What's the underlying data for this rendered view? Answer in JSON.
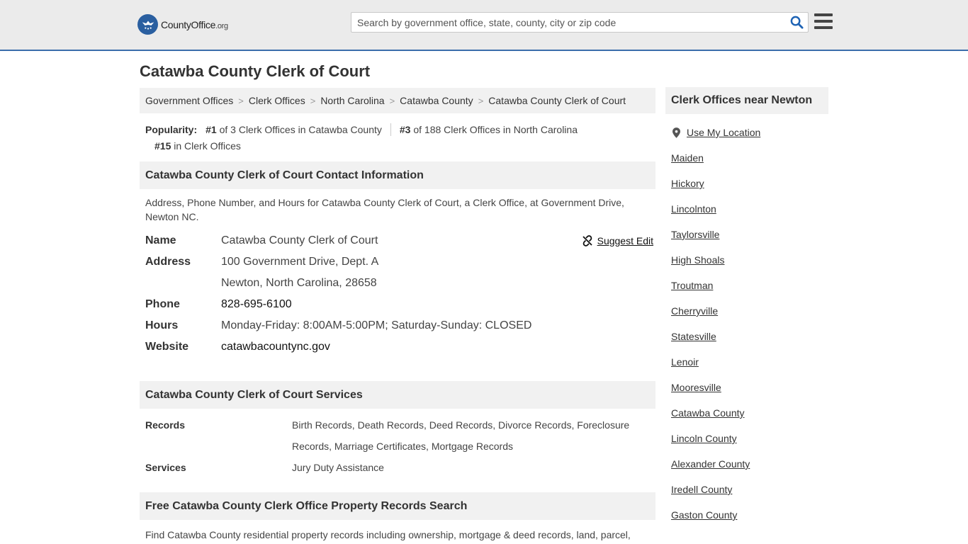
{
  "header": {
    "logo_text_main": "CountyOffice",
    "logo_text_tld": ".org",
    "search_placeholder": "Search by government office, state, county, city or zip code",
    "search_value": ""
  },
  "page": {
    "title": "Catawba County Clerk of Court"
  },
  "breadcrumb": [
    "Government Offices",
    "Clerk Offices",
    "North Carolina",
    "Catawba County",
    "Catawba County Clerk of Court"
  ],
  "popularity": {
    "label": "Popularity:",
    "rank1": "#1",
    "rank1_text": "of 3 Clerk Offices in Catawba County",
    "rank2": "#3",
    "rank2_text": "of 188 Clerk Offices in North Carolina",
    "rank3": "#15",
    "rank3_text": "in Clerk Offices"
  },
  "contact": {
    "header": "Catawba County Clerk of Court Contact Information",
    "description": "Address, Phone Number, and Hours for Catawba County Clerk of Court, a Clerk Office, at Government Drive, Newton NC.",
    "suggest_edit": "Suggest Edit",
    "name_label": "Name",
    "name": "Catawba County Clerk of Court",
    "address_label": "Address",
    "address_line1": "100 Government Drive, Dept. A",
    "address_line2": "Newton, North Carolina, 28658",
    "phone_label": "Phone",
    "phone": "828-695-6100",
    "hours_label": "Hours",
    "hours": "Monday-Friday: 8:00AM-5:00PM; Saturday-Sunday: CLOSED",
    "website_label": "Website",
    "website": "catawbacountync.gov"
  },
  "services": {
    "header": "Catawba County Clerk of Court Services",
    "records_label": "Records",
    "records": "Birth Records, Death Records, Deed Records, Divorce Records, Foreclosure Records, Marriage Certificates, Mortgage Records",
    "services_label": "Services",
    "services": "Jury Duty Assistance"
  },
  "property": {
    "header": "Free Catawba County Clerk Office Property Records Search",
    "description": "Find Catawba County residential property records including ownership, mortgage & deed records, land, parcel,"
  },
  "sidebar": {
    "header": "Clerk Offices near Newton",
    "use_location": "Use My Location",
    "items": [
      "Maiden",
      "Hickory",
      "Lincolnton",
      "Taylorsville",
      "High Shoals",
      "Troutman",
      "Cherryville",
      "Statesville",
      "Lenoir",
      "Mooresville",
      "Catawba County",
      "Lincoln County",
      "Alexander County",
      "Iredell County",
      "Gaston County"
    ]
  },
  "colors": {
    "brand_blue": "#2a5fa0",
    "header_bg": "#ebebeb",
    "section_bg": "#f1f1f1",
    "search_icon": "#1e63b4"
  }
}
